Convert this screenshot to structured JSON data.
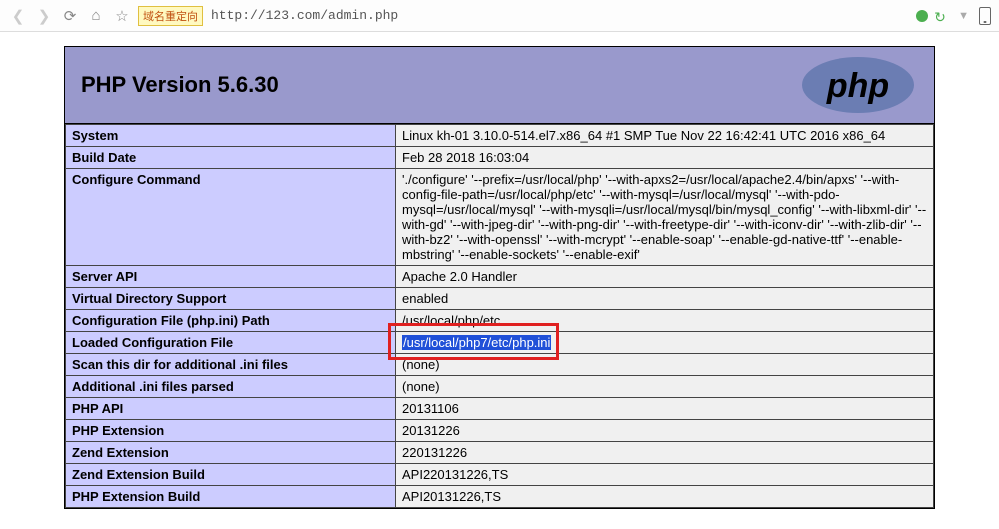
{
  "browser": {
    "badge": "域名重定向",
    "url": "http://123.com/admin.php"
  },
  "header": {
    "title": "PHP Version 5.6.30"
  },
  "rows": [
    {
      "k": "System",
      "v": "Linux kh-01 3.10.0-514.el7.x86_64 #1 SMP Tue Nov 22 16:42:41 UTC 2016 x86_64"
    },
    {
      "k": "Build Date",
      "v": "Feb 28 2018 16:03:04"
    },
    {
      "k": "Configure Command",
      "v": " './configure'  '--prefix=/usr/local/php'  '--with-apxs2=/usr/local/apache2.4/bin/apxs'  '--with-config-file-path=/usr/local/php/etc'  '--with-mysql=/usr/local/mysql'  '--with-pdo-mysql=/usr/local/mysql'  '--with-mysqli=/usr/local/mysql/bin/mysql_config'  '--with-libxml-dir'  '--with-gd'  '--with-jpeg-dir'  '--with-png-dir'  '--with-freetype-dir'  '--with-iconv-dir'  '--with-zlib-dir'  '--with-bz2'  '--with-openssl'  '--with-mcrypt'  '--enable-soap'  '--enable-gd-native-ttf'  '--enable-mbstring'  '--enable-sockets'  '--enable-exif'"
    },
    {
      "k": "Server API",
      "v": "Apache 2.0 Handler"
    },
    {
      "k": "Virtual Directory Support",
      "v": "enabled"
    },
    {
      "k": "Configuration File (php.ini) Path",
      "v": "/usr/local/php/etc"
    },
    {
      "k": "Loaded Configuration File",
      "v": "/usr/local/php7/etc/php.ini",
      "highlighted": true
    },
    {
      "k": "Scan this dir for additional .ini files",
      "v": "(none)"
    },
    {
      "k": "Additional .ini files parsed",
      "v": "(none)"
    },
    {
      "k": "PHP API",
      "v": "20131106"
    },
    {
      "k": "PHP Extension",
      "v": "20131226"
    },
    {
      "k": "Zend Extension",
      "v": "220131226"
    },
    {
      "k": "Zend Extension Build",
      "v": "API220131226,TS"
    },
    {
      "k": "PHP Extension Build",
      "v": "API20131226,TS"
    }
  ]
}
